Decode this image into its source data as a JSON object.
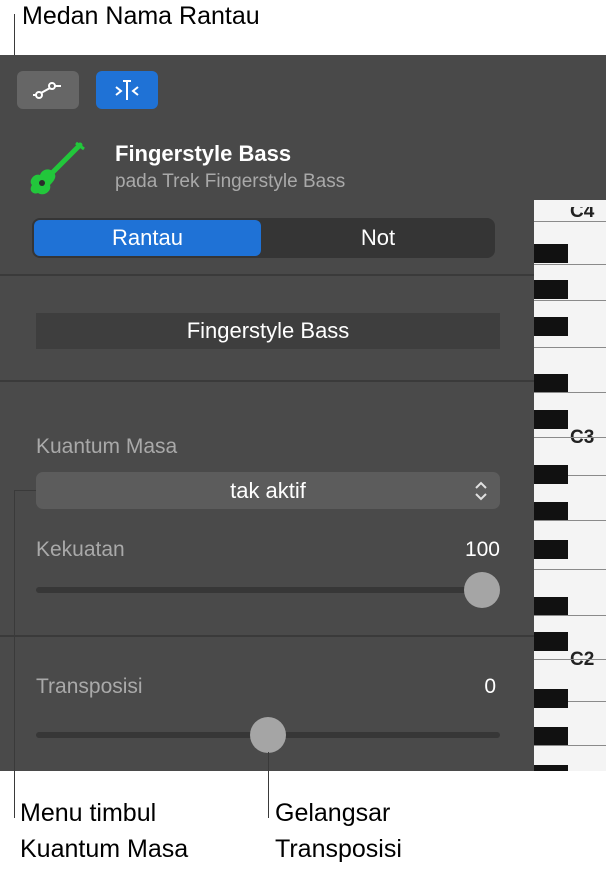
{
  "callouts": {
    "region_name_field": "Medan Nama Rantau",
    "quantize_menu_line1": "Menu timbul",
    "quantize_menu_line2": "Kuantum Masa",
    "transpose_slider_line1": "Gelangsar",
    "transpose_slider_line2": "Transposisi"
  },
  "toolbar": {
    "automation_icon": "automation-curve-icon",
    "smart_controls_icon": "smart-controls-icon"
  },
  "track": {
    "name": "Fingerstyle Bass",
    "subtitle": "pada Trek Fingerstyle Bass",
    "icon": "bass-guitar-icon",
    "icon_color": "#22c73b"
  },
  "segmented": {
    "options": [
      "Rantau",
      "Not"
    ],
    "selected": "Rantau"
  },
  "region": {
    "name_value": "Fingerstyle Bass"
  },
  "quantize": {
    "label": "Kuantum Masa",
    "selected": "tak aktif"
  },
  "strength": {
    "label": "Kekuatan",
    "value": "100",
    "fraction": 1.0
  },
  "transpose": {
    "label": "Transposisi",
    "value": "0",
    "fraction": 0.5
  },
  "keyboard": {
    "octave_labels": [
      "C4",
      "C3",
      "C2"
    ]
  },
  "colors": {
    "accent": "#1f72d6",
    "panel": "#4a4a4a"
  }
}
